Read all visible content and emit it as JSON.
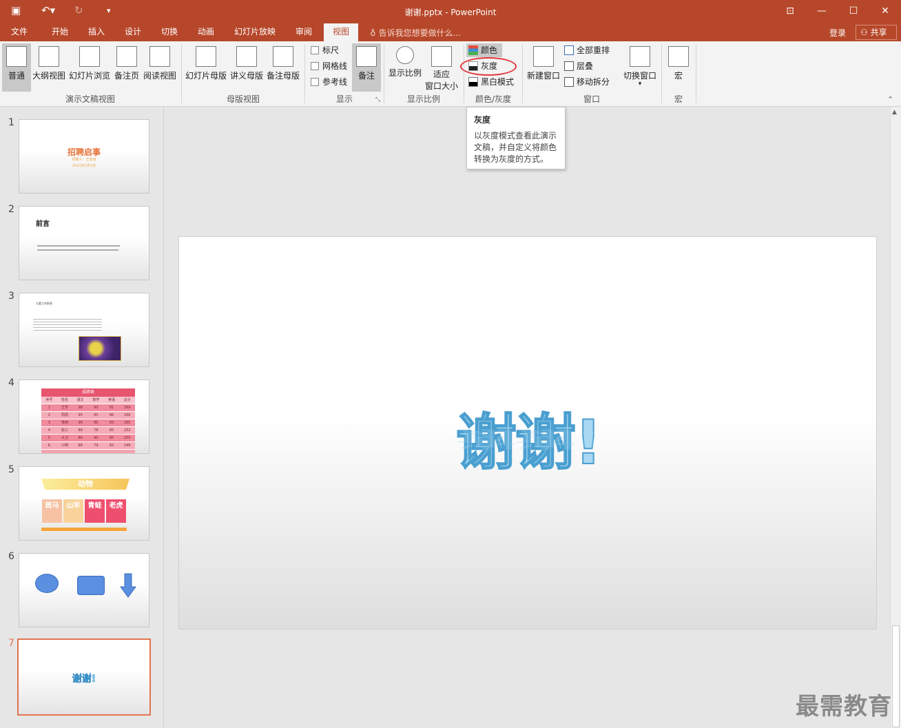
{
  "window": {
    "title": "谢谢.pptx - PowerPoint"
  },
  "tabs": [
    "文件",
    "开始",
    "插入",
    "设计",
    "切换",
    "动画",
    "幻灯片放映",
    "审阅",
    "视图"
  ],
  "active_tab": "视图",
  "tell_me": "告诉我您想要做什么...",
  "account": {
    "login": "登录",
    "share": "共享"
  },
  "ribbon": {
    "presentation_views": {
      "label": "演示文稿视图",
      "buttons": [
        "普通",
        "大纲视图",
        "幻灯片浏览",
        "备注页",
        "阅读视图"
      ]
    },
    "master_views": {
      "label": "母版视图",
      "buttons": [
        "幻灯片母版",
        "讲义母版",
        "备注母版"
      ]
    },
    "show": {
      "label": "显示",
      "checkboxes": [
        "标尺",
        "网格线",
        "参考线"
      ],
      "notes": "备注"
    },
    "zoom": {
      "label": "显示比例",
      "zoom": "显示比例",
      "fit_line1": "适应",
      "fit_line2": "窗口大小"
    },
    "color_gray": {
      "label": "颜色/灰度",
      "color": "颜色",
      "grayscale": "灰度",
      "bw": "黑白模式"
    },
    "window": {
      "label": "窗口",
      "new_window": "新建窗口",
      "arrange_all": "全部重排",
      "cascade": "层叠",
      "move_split": "移动拆分",
      "switch": "切换窗口"
    },
    "macros": {
      "label": "宏",
      "macros": "宏"
    }
  },
  "tooltip": {
    "title": "灰度",
    "body": "以灰度模式查看此演示文稿，并自定义将颜色转换为灰度的方式。"
  },
  "slides": [
    {
      "num": "1",
      "title": "招聘启事",
      "sub": "招聘人：王佳琪",
      "date": "2021年1月1日"
    },
    {
      "num": "2",
      "heading": "前言"
    },
    {
      "num": "3",
      "heading": "主要工作职责"
    },
    {
      "num": "4",
      "table_title": "成绩表",
      "headers": [
        "序号",
        "姓名",
        "语文",
        "数学",
        "英语",
        "总分"
      ],
      "rows": [
        [
          "1",
          "王芳",
          "98",
          "90",
          "81",
          "269"
        ],
        [
          "2",
          "周周",
          "95",
          "85",
          "86",
          "266"
        ],
        [
          "3",
          "李西",
          "96",
          "86",
          "83",
          "265"
        ],
        [
          "4",
          "张三",
          "89",
          "78",
          "85",
          "252"
        ],
        [
          "5",
          "大卫",
          "80",
          "90",
          "85",
          "255"
        ],
        [
          "6",
          "小明",
          "88",
          "79",
          "82",
          "249"
        ]
      ]
    },
    {
      "num": "5",
      "banner": "动物",
      "cards": [
        "斑马",
        "山羊",
        "青蛙",
        "老虎"
      ]
    },
    {
      "num": "6"
    },
    {
      "num": "7",
      "text": "谢谢!"
    }
  ],
  "current_slide": {
    "text": "谢谢!"
  },
  "watermark": "最需教育"
}
